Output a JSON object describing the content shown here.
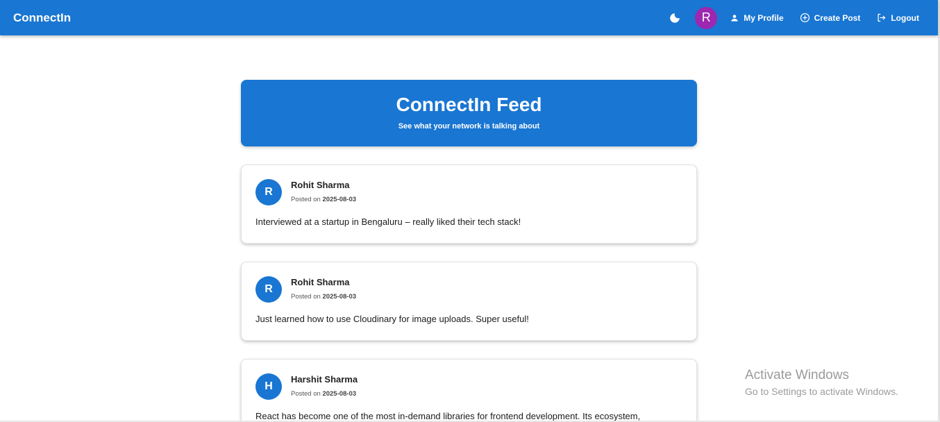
{
  "navbar": {
    "brand": "ConnectIn",
    "avatar_letter": "R",
    "avatar_color": "#9c27b0",
    "links": [
      {
        "label": "My Profile",
        "icon": "person-icon"
      },
      {
        "label": "Create Post",
        "icon": "add-circle-icon"
      },
      {
        "label": "Logout",
        "icon": "logout-icon"
      }
    ],
    "theme_icon": "moon-icon"
  },
  "header": {
    "title": "ConnectIn Feed",
    "subtitle": "See what your network is talking about"
  },
  "posts": [
    {
      "initial": "R",
      "author": "Rohit Sharma",
      "posted_prefix": "Posted on",
      "date": "2025-08-03",
      "content": "Interviewed at a startup in Bengaluru – really liked their tech stack!"
    },
    {
      "initial": "R",
      "author": "Rohit Sharma",
      "posted_prefix": "Posted on",
      "date": "2025-08-03",
      "content": "Just learned how to use Cloudinary for image uploads. Super useful!"
    },
    {
      "initial": "H",
      "author": "Harshit Sharma",
      "posted_prefix": "Posted on",
      "date": "2025-08-03",
      "content": "React has become one of the most in-demand libraries for frontend development. Its ecosystem,"
    }
  ],
  "watermark": {
    "title": "Activate Windows",
    "subtitle": "Go to Settings to activate Windows."
  },
  "colors": {
    "primary": "#1976d2",
    "avatar_purple": "#9c27b0"
  }
}
